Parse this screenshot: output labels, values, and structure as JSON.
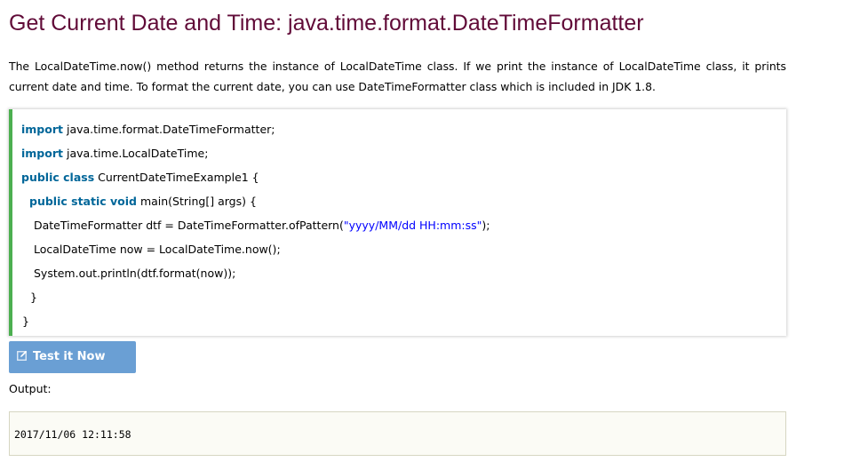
{
  "page": {
    "title": "Get Current Date and Time: java.time.format.DateTimeFormatter",
    "intro": "The LocalDateTime.now() method returns the instance of LocalDateTime class. If we print the instance of LocalDateTime class, it prints current date and time. To format the current date, you can use DateTimeFormatter class which is included in JDK 1.8."
  },
  "code": {
    "line1": {
      "kw": "import",
      "rest": " java.time.format.DateTimeFormatter;"
    },
    "line2": {
      "kw": "import",
      "rest": " java.time.LocalDateTime;"
    },
    "line3": {
      "kw": "public class",
      "rest": " CurrentDateTimeExample1 {"
    },
    "line4": {
      "kw": "public static void",
      "rest": " main(String[] args) {"
    },
    "line5": {
      "pre": "DateTimeFormatter dtf = DateTimeFormatter.ofPattern(",
      "str": "\"yyyy/MM/dd HH:mm:ss\"",
      "post": ");"
    },
    "line6": {
      "text": "LocalDateTime now = LocalDateTime.now();"
    },
    "line7": {
      "text": "System.out.println(dtf.format(now));"
    },
    "line8": {
      "text": "}"
    },
    "line9": {
      "text": "}"
    }
  },
  "button": {
    "label": "Test it Now",
    "icon": "edit-icon"
  },
  "output": {
    "label": "Output:",
    "value": "2017/11/06 12:11:58"
  },
  "colors": {
    "title": "#610b38",
    "keyword": "#006699",
    "string": "#0000ff",
    "accent_bar": "#4caf50",
    "button_bg": "#6a9fd4"
  }
}
